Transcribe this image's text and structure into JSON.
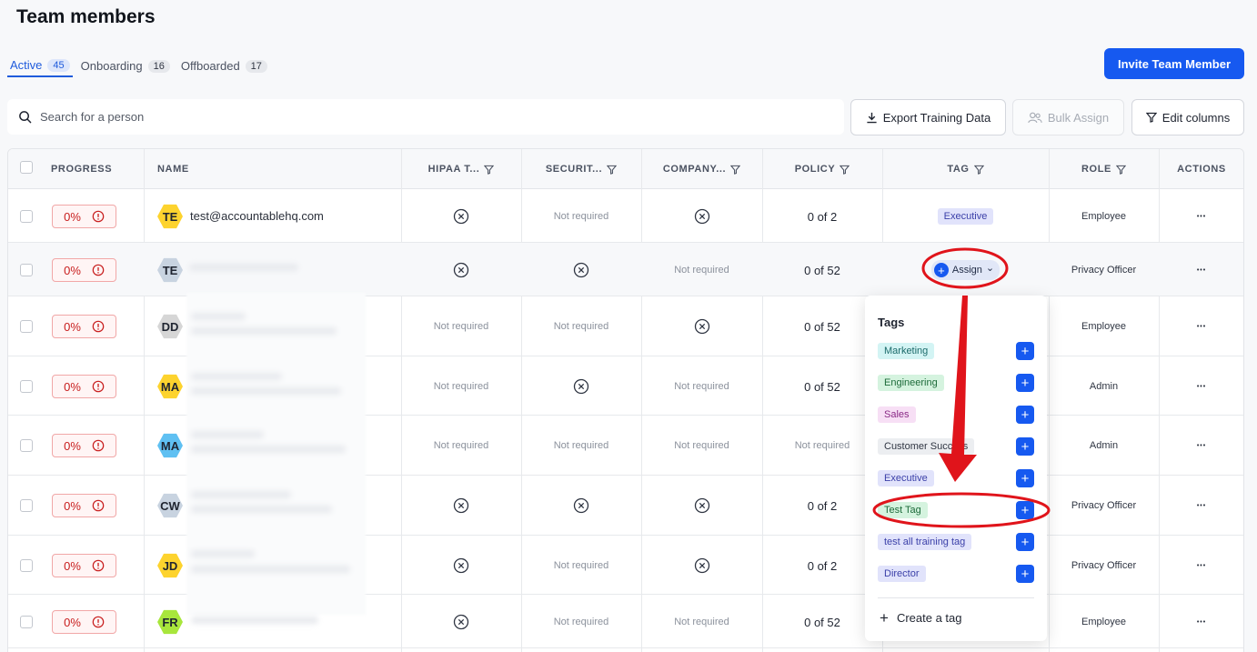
{
  "page": {
    "title": "Team members"
  },
  "tabs": [
    {
      "label": "Active",
      "count": "45"
    },
    {
      "label": "Onboarding",
      "count": "16"
    },
    {
      "label": "Offboarded",
      "count": "17"
    }
  ],
  "invite_label": "Invite Team Member",
  "search": {
    "placeholder": "Search for a person"
  },
  "toolbar": {
    "export_label": "Export Training Data",
    "bulk_label": "Bulk Assign",
    "edit_label": "Edit columns"
  },
  "columns": [
    "PROGRESS",
    "NAME",
    "HIPAA T...",
    "SECURIT...",
    "COMPANY...",
    "POLICY",
    "TAG",
    "ROLE",
    "ACTIONS"
  ],
  "rows": [
    {
      "progress": "0%",
      "initials": "TE",
      "avatar_color": "#fdd32e",
      "name": "test@accountablehq.com",
      "hipaa": "x",
      "security": "Not required",
      "company": "x",
      "policy": "0 of 2",
      "tag": "Executive",
      "role": "Employee"
    },
    {
      "progress": "0%",
      "initials": "TE",
      "avatar_color": "#c8d3e0",
      "name": "",
      "hipaa": "x",
      "security": "x",
      "company": "Not required",
      "policy": "0 of 52",
      "tag": "Assign",
      "role": "Privacy Officer"
    },
    {
      "progress": "0%",
      "initials": "DD",
      "avatar_color": "#d6d6d6",
      "name": "",
      "hipaa": "Not required",
      "security": "Not required",
      "company": "x",
      "policy": "0 of 52",
      "tag": "",
      "role": "Employee"
    },
    {
      "progress": "0%",
      "initials": "MA",
      "avatar_color": "#fdd32e",
      "name": "",
      "hipaa": "Not required",
      "security": "x",
      "company": "Not required",
      "policy": "0 of 52",
      "tag": "",
      "role": "Admin"
    },
    {
      "progress": "0%",
      "initials": "MA",
      "avatar_color": "#5fc0f2",
      "name": "",
      "hipaa": "Not required",
      "security": "Not required",
      "company": "Not required",
      "policy": "Not required",
      "tag": "",
      "role": "Admin"
    },
    {
      "progress": "0%",
      "initials": "CW",
      "avatar_color": "#c8d3e0",
      "name": "",
      "hipaa": "x",
      "security": "x",
      "company": "x",
      "policy": "0 of 2",
      "tag": "",
      "role": "Privacy Officer"
    },
    {
      "progress": "0%",
      "initials": "JD",
      "avatar_color": "#fdd32e",
      "name": "",
      "hipaa": "x",
      "security": "Not required",
      "company": "x",
      "policy": "0 of 2",
      "tag": "",
      "role": "Privacy Officer"
    },
    {
      "progress": "0%",
      "initials": "FR",
      "avatar_color": "#a8e63c",
      "name": "",
      "hipaa": "x",
      "security": "Not required",
      "company": "Not required",
      "policy": "0 of 52",
      "tag": "",
      "role": "Employee"
    }
  ],
  "tag_dropdown": {
    "title": "Tags",
    "tags": [
      {
        "label": "Marketing",
        "bg": "#d3f4f4",
        "fg": "#1c6b6b"
      },
      {
        "label": "Engineering",
        "bg": "#d5f3df",
        "fg": "#1d6b3a"
      },
      {
        "label": "Sales",
        "bg": "#f7dff5",
        "fg": "#8a2a86"
      },
      {
        "label": "Customer Success",
        "bg": "#eceef1",
        "fg": "#2f3542"
      },
      {
        "label": "Executive",
        "bg": "#e1e3fb",
        "fg": "#3a3fa8"
      },
      {
        "label": "Test Tag",
        "bg": "#d5f3df",
        "fg": "#1d6b3a"
      },
      {
        "label": "test all training tag",
        "bg": "#e1e3fb",
        "fg": "#3a3fa8"
      },
      {
        "label": "Director",
        "bg": "#e1e3fb",
        "fg": "#3a3fa8"
      }
    ],
    "create_label": "Create a tag"
  },
  "colors": {
    "accent": "#1659f0",
    "annotation": "#e0141b"
  }
}
